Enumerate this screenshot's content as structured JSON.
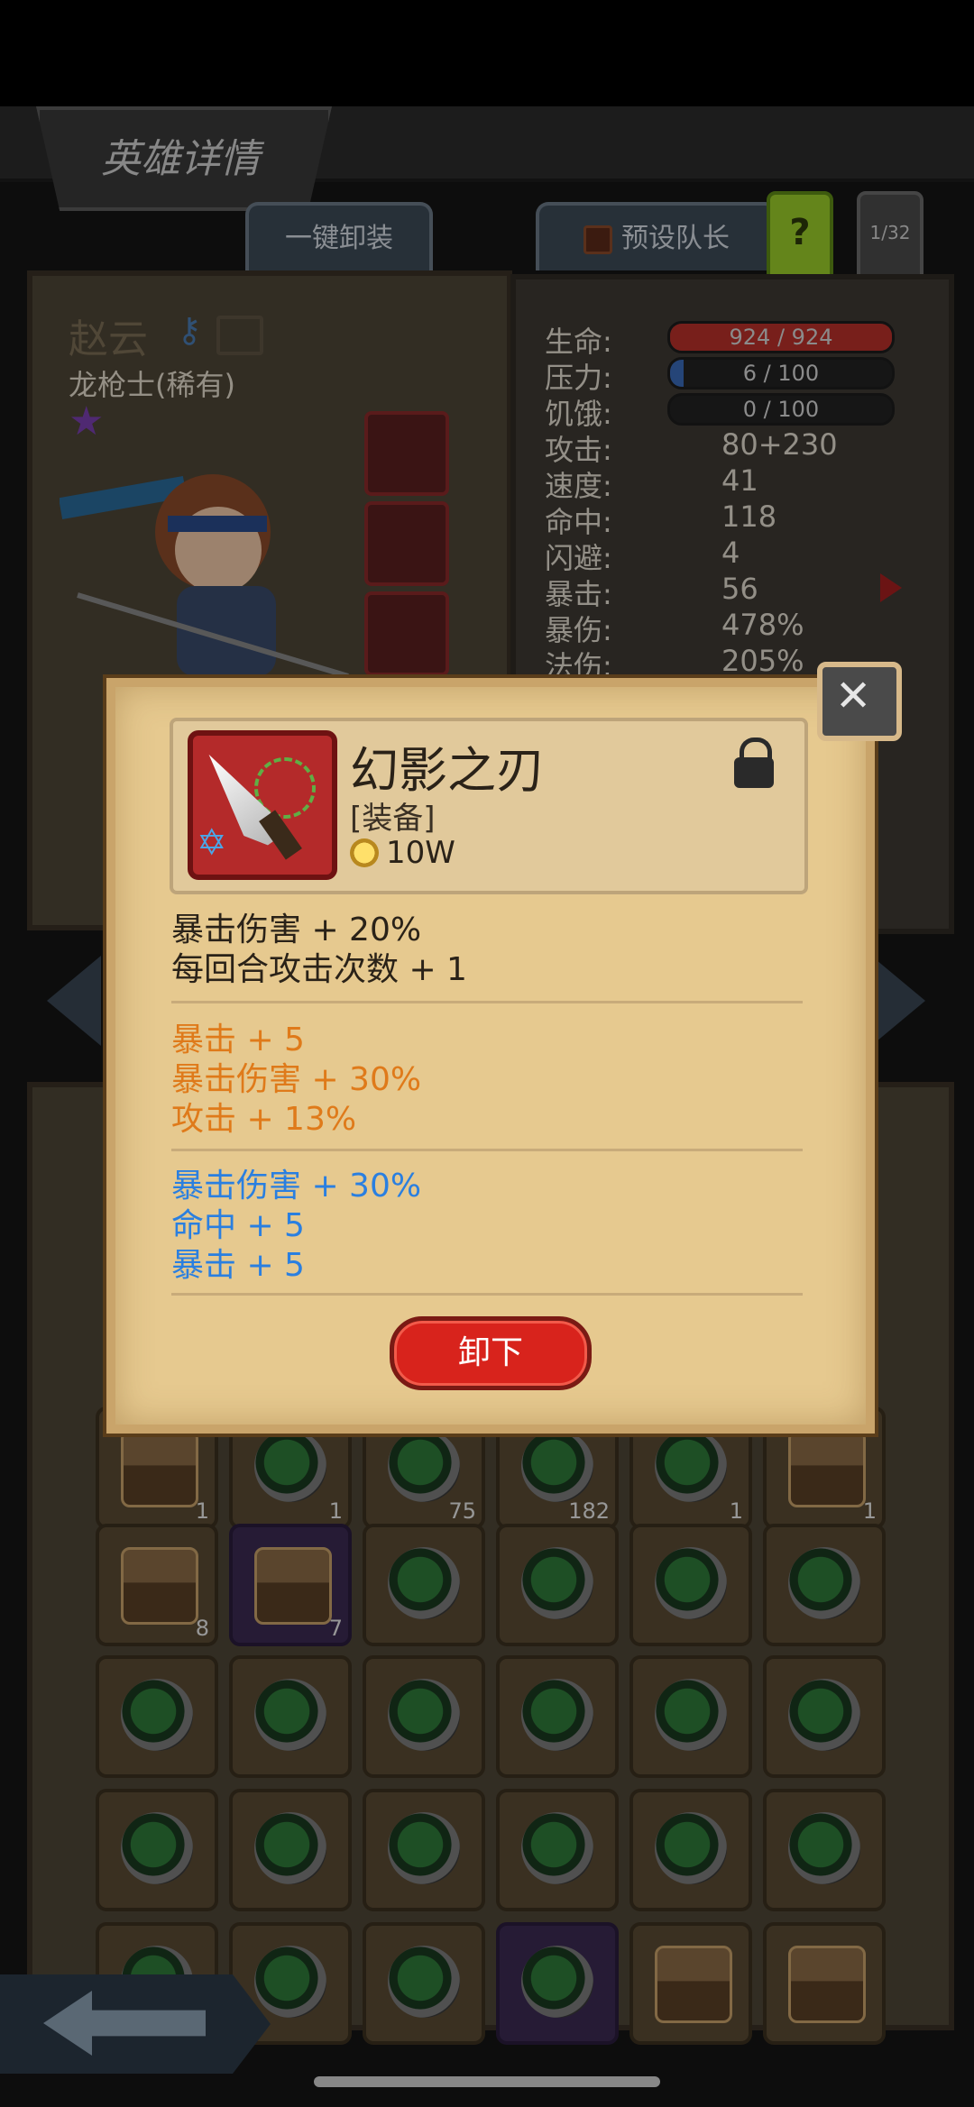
{
  "header": {
    "title": "英雄详情",
    "unequip_all_label": "一键卸装",
    "preset_leader_label": "预设队长",
    "help_label": "?",
    "page_indicator": "1/32"
  },
  "hero": {
    "name": "赵云",
    "class": "龙枪士(稀有)"
  },
  "stats": {
    "hp": {
      "label": "生命:",
      "value": "924 / 924",
      "fill": 1.0
    },
    "stress": {
      "label": "压力:",
      "value": "6 / 100",
      "fill": 0.06
    },
    "hunger": {
      "label": "饥饿:",
      "value": "0 / 100",
      "fill": 0.0
    },
    "rows": [
      {
        "label": "攻击:",
        "value": "80+230"
      },
      {
        "label": "速度:",
        "value": "41"
      },
      {
        "label": "命中:",
        "value": "118"
      },
      {
        "label": "闪避:",
        "value": "4"
      },
      {
        "label": "暴击:",
        "value": "56"
      },
      {
        "label": "暴伤:",
        "value": "478%"
      },
      {
        "label": "法伤:",
        "value": "205%"
      }
    ]
  },
  "item_modal": {
    "name": "幻影之刃",
    "type": "[装备]",
    "price": "10W",
    "base_effects": [
      "暴击伤害 + 20%",
      "每回合攻击次数 + 1"
    ],
    "orange_effects": [
      "暴击 + 5",
      "暴击伤害 + 30%",
      "攻击 + 13%"
    ],
    "blue_effects": [
      "暴击伤害 + 30%",
      "命中 + 5",
      "暴击 + 5"
    ],
    "unequip_label": "卸下",
    "colors": {
      "orange": "#df7a1a",
      "blue": "#2a7fe0",
      "button": "#d8231c"
    }
  },
  "bag": {
    "row1_counts": [
      "1",
      "1",
      "75",
      "182",
      "1",
      "1"
    ],
    "row2_counts": [
      "8",
      "7",
      "",
      "",
      "",
      ""
    ]
  }
}
